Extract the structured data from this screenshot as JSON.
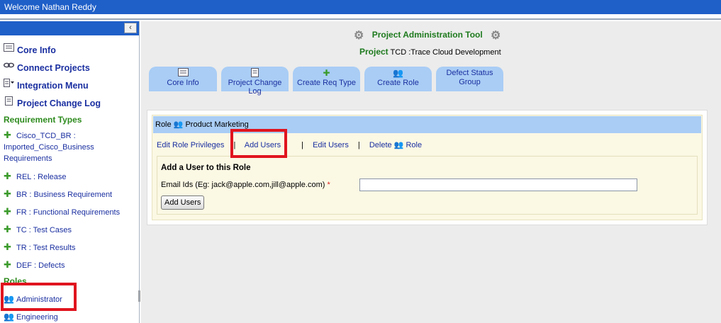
{
  "header": {
    "welcome": "Welcome Nathan Reddy"
  },
  "sidebar": {
    "collapse_icon": "‹",
    "links": [
      {
        "label": "Core Info",
        "icon": "form-icon"
      },
      {
        "label": "Connect Projects",
        "icon": "link-icon"
      },
      {
        "label": "Integration Menu",
        "icon": "menu-icon"
      },
      {
        "label": "Project Change Log",
        "icon": "document-icon"
      }
    ],
    "requirement_types_heading": "Requirement Types",
    "requirement_types": [
      {
        "line1": "Cisco_TCD_BR :",
        "line2": "Imported_Cisco_Business",
        "line3": "Requirements"
      },
      {
        "label": "REL : Release"
      },
      {
        "label": "BR : Business Requirement"
      },
      {
        "label": "FR : Functional Requirements"
      },
      {
        "label": "TC : Test Cases"
      },
      {
        "label": "TR : Test Results"
      },
      {
        "label": "DEF : Defects"
      }
    ],
    "roles_heading": "Roles",
    "roles": [
      {
        "label": "Administrator"
      },
      {
        "label": "Engineering"
      }
    ]
  },
  "main": {
    "title": "Project Administration Tool",
    "project_label": "Project",
    "project_value": "TCD :Trace Cloud Development",
    "tabs": [
      {
        "label": "Core Info",
        "icon": "form-icon"
      },
      {
        "label": "Project Change Log",
        "icon": "document-icon"
      },
      {
        "label": "Create Req Type",
        "icon": "puzzle-icon"
      },
      {
        "label": "Create Role",
        "icon": "role-icon"
      },
      {
        "label_line1": "Defect Status",
        "label_line2": "Group"
      }
    ],
    "role_bar": {
      "label": "Role",
      "role_name": "Product Marketing"
    },
    "actions": {
      "edit_privileges": "Edit Role Privileges",
      "add_users": "Add Users",
      "edit_users": "Edit Users",
      "delete": "Delete",
      "delete_role": "Role"
    },
    "add_form": {
      "title": "Add a User to this Role",
      "email_label": "Email Ids (Eg: jack@apple.com,jill@apple.com)",
      "required_mark": "*",
      "email_value": "",
      "submit_label": "Add Users"
    }
  },
  "colors": {
    "header_blue": "#1f5fc8",
    "tab_blue": "#a9cdf5",
    "link_blue": "#1a2fa0",
    "heading_green": "#2e8b1e",
    "highlight_red": "#e0141e"
  }
}
